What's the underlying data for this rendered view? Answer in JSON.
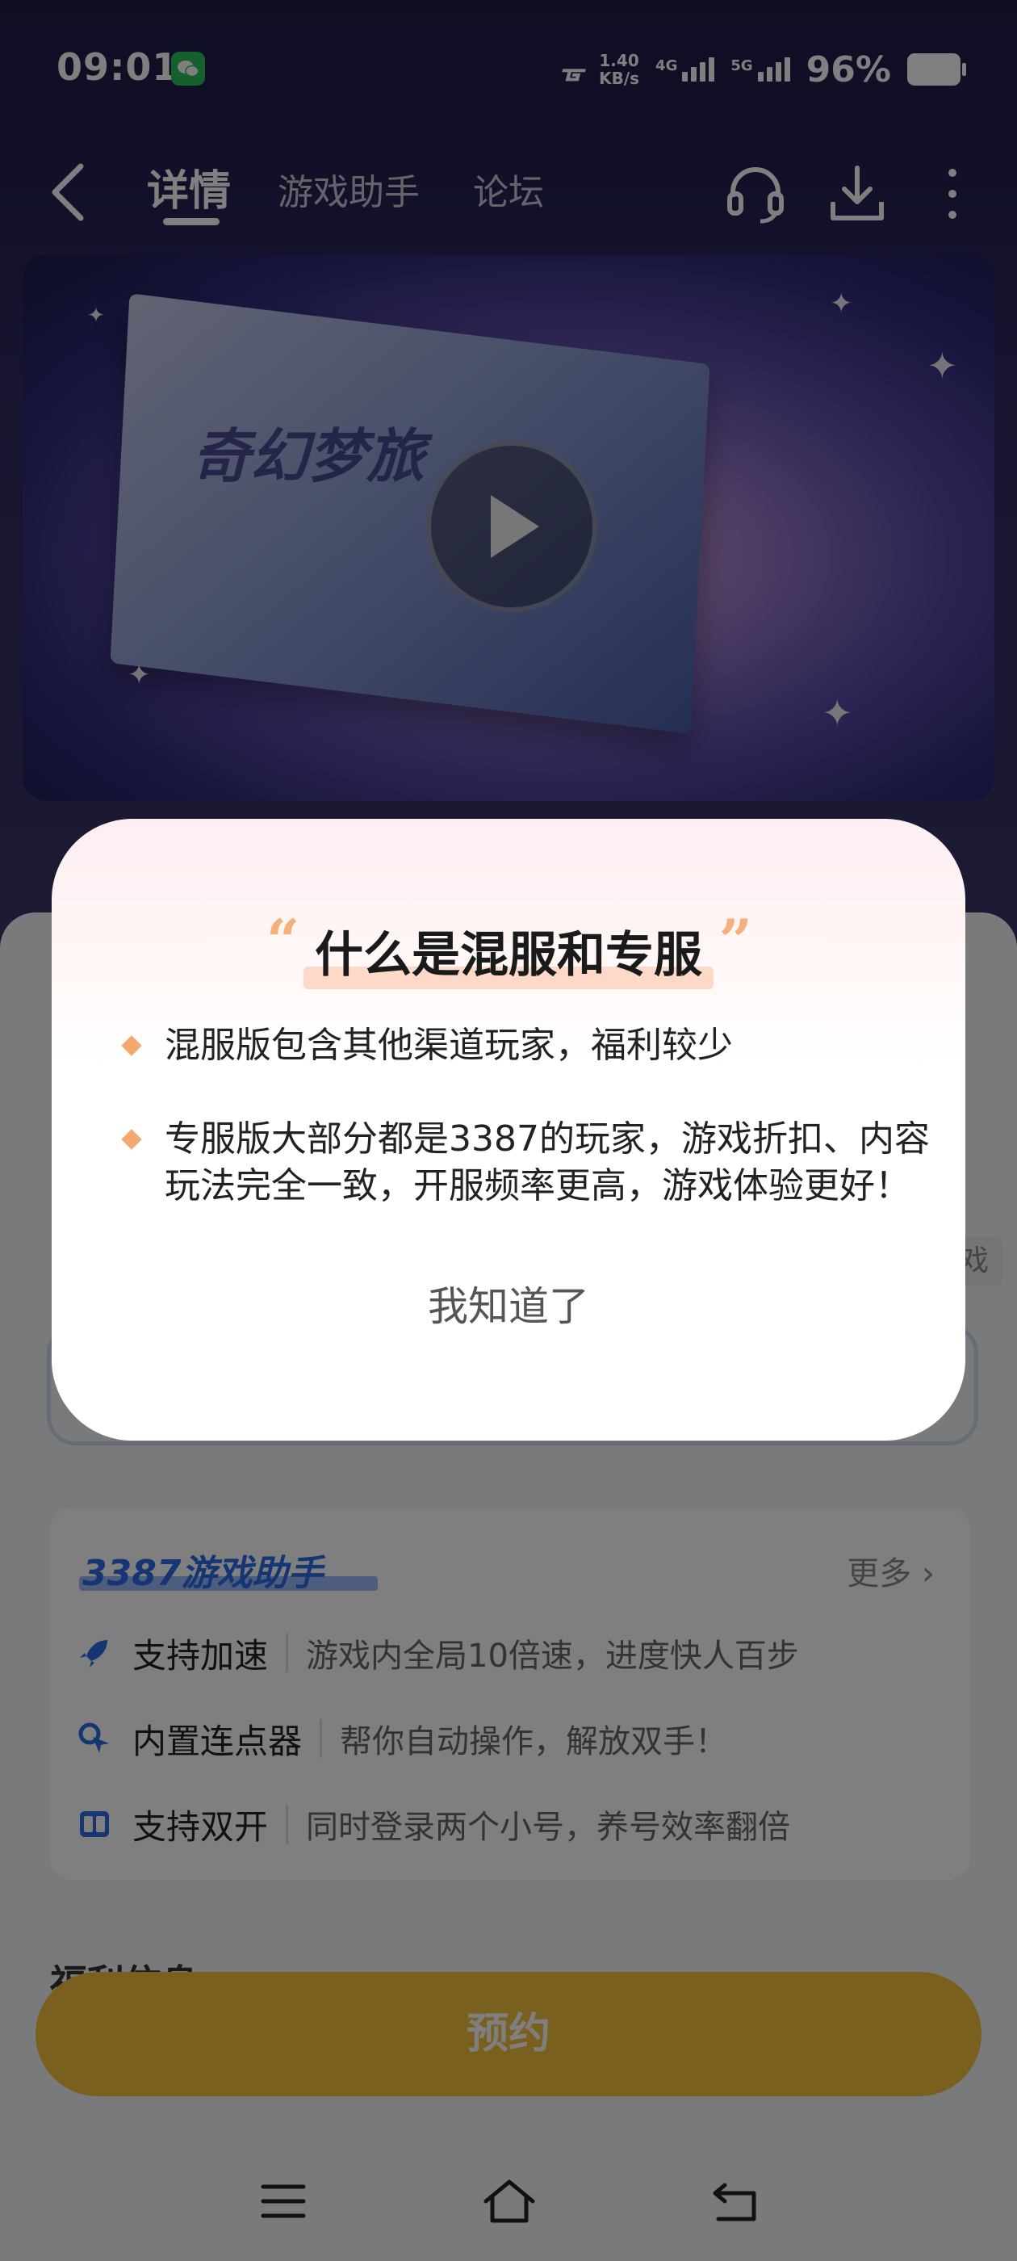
{
  "status_bar": {
    "time": "09:01",
    "net_speed_value": "1.40",
    "net_speed_unit": "KB/s",
    "sim1": "4G",
    "sim2": "5G",
    "battery": "96%"
  },
  "nav": {
    "tabs": [
      "详情",
      "游戏助手",
      "论坛"
    ],
    "active_tab": "详情"
  },
  "banner": {
    "title_art": "奇幻梦旅"
  },
  "helper": {
    "title": "3387游戏助手",
    "more": "更多",
    "features": [
      {
        "name": "支持加速",
        "desc": "游戏内全局10倍速，进度快人百步",
        "icon": "rocket-icon"
      },
      {
        "name": "内置连点器",
        "desc": "帮你自动操作，解放双手！",
        "icon": "clicker-icon"
      },
      {
        "name": "支持双开",
        "desc": "同时登录两个小号，养号效率翻倍",
        "icon": "dual-icon"
      }
    ]
  },
  "welfare": {
    "title": "福利信息"
  },
  "side_chip": "戏",
  "reserve_button": "预约",
  "dialog": {
    "title": "什么是混服和专服",
    "items": [
      "混服版包含其他渠道玩家，福利较少",
      "专服版大部分都是3387的玩家，游戏折扣、内容玩法完全一致，开服频率更高，游戏体验更好！"
    ],
    "confirm": "我知道了"
  },
  "colors": {
    "accent_orange": "#f3a86f",
    "reserve_yellow": "#f2c13c",
    "helper_blue": "#2a6ae6"
  }
}
